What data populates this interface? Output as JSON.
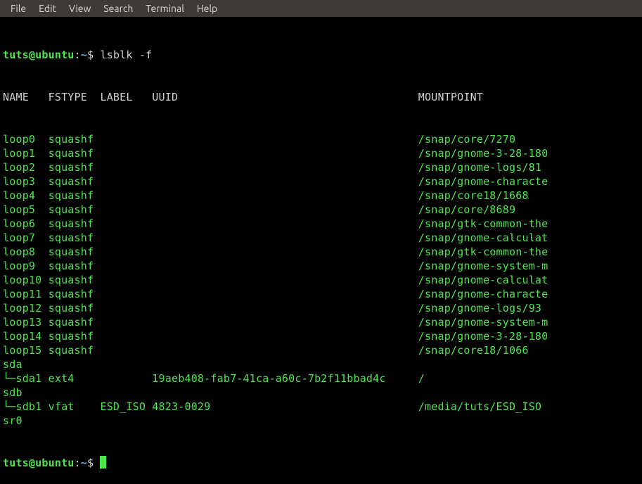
{
  "menubar": {
    "items": [
      "File",
      "Edit",
      "View",
      "Search",
      "Terminal",
      "Help"
    ]
  },
  "prompt": {
    "user_host": "tuts@ubuntu",
    "colon": ":",
    "path": "~",
    "dollar": "$"
  },
  "command": "lsblk -f",
  "headers": {
    "name": "NAME",
    "fstype": "FSTYPE",
    "label": "LABEL",
    "uuid": "UUID",
    "mountpoint": "MOUNTPOINT"
  },
  "rows": [
    {
      "name": "loop0",
      "fstype": "squashf",
      "label": "",
      "uuid": "",
      "mountpoint": "/snap/core/7270"
    },
    {
      "name": "loop1",
      "fstype": "squashf",
      "label": "",
      "uuid": "",
      "mountpoint": "/snap/gnome-3-28-180"
    },
    {
      "name": "loop2",
      "fstype": "squashf",
      "label": "",
      "uuid": "",
      "mountpoint": "/snap/gnome-logs/81"
    },
    {
      "name": "loop3",
      "fstype": "squashf",
      "label": "",
      "uuid": "",
      "mountpoint": "/snap/gnome-characte"
    },
    {
      "name": "loop4",
      "fstype": "squashf",
      "label": "",
      "uuid": "",
      "mountpoint": "/snap/core18/1668"
    },
    {
      "name": "loop5",
      "fstype": "squashf",
      "label": "",
      "uuid": "",
      "mountpoint": "/snap/core/8689"
    },
    {
      "name": "loop6",
      "fstype": "squashf",
      "label": "",
      "uuid": "",
      "mountpoint": "/snap/gtk-common-the"
    },
    {
      "name": "loop7",
      "fstype": "squashf",
      "label": "",
      "uuid": "",
      "mountpoint": "/snap/gnome-calculat"
    },
    {
      "name": "loop8",
      "fstype": "squashf",
      "label": "",
      "uuid": "",
      "mountpoint": "/snap/gtk-common-the"
    },
    {
      "name": "loop9",
      "fstype": "squashf",
      "label": "",
      "uuid": "",
      "mountpoint": "/snap/gnome-system-m"
    },
    {
      "name": "loop10",
      "fstype": "squashf",
      "label": "",
      "uuid": "",
      "mountpoint": "/snap/gnome-calculat"
    },
    {
      "name": "loop11",
      "fstype": "squashf",
      "label": "",
      "uuid": "",
      "mountpoint": "/snap/gnome-characte"
    },
    {
      "name": "loop12",
      "fstype": "squashf",
      "label": "",
      "uuid": "",
      "mountpoint": "/snap/gnome-logs/93"
    },
    {
      "name": "loop13",
      "fstype": "squashf",
      "label": "",
      "uuid": "",
      "mountpoint": "/snap/gnome-system-m"
    },
    {
      "name": "loop14",
      "fstype": "squashf",
      "label": "",
      "uuid": "",
      "mountpoint": "/snap/gnome-3-28-180"
    },
    {
      "name": "loop15",
      "fstype": "squashf",
      "label": "",
      "uuid": "",
      "mountpoint": "/snap/core18/1066"
    },
    {
      "name": "sda",
      "fstype": "",
      "label": "",
      "uuid": "",
      "mountpoint": ""
    },
    {
      "name": "└─sda1",
      "fstype": "ext4",
      "label": "",
      "uuid": "19aeb408-fab7-41ca-a60c-7b2f11bbad4c",
      "mountpoint": "/"
    },
    {
      "name": "sdb",
      "fstype": "",
      "label": "",
      "uuid": "",
      "mountpoint": ""
    },
    {
      "name": "└─sdb1",
      "fstype": "vfat",
      "label": "ESD_ISO",
      "uuid": "4823-0029",
      "mountpoint": "/media/tuts/ESD_ISO"
    },
    {
      "name": "sr0",
      "fstype": "",
      "label": "",
      "uuid": "",
      "mountpoint": ""
    }
  ],
  "column_widths": {
    "name": 7,
    "fstype": 8,
    "label": 8,
    "uuid": 41,
    "mountpoint": 20
  }
}
